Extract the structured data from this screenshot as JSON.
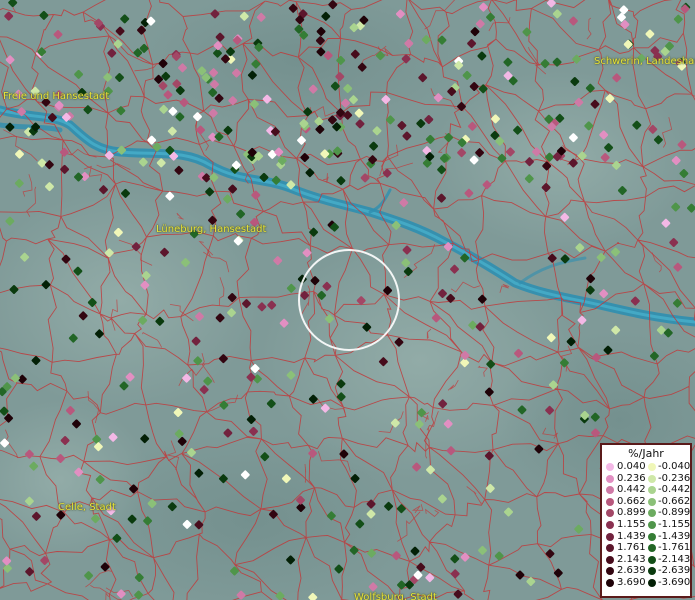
{
  "map": {
    "background_color": "#7f9a98",
    "river_color": "#2f8fb0",
    "boundary_color": "#c0393b",
    "label_color": "#e8e43a",
    "places": [
      {
        "id": "hamburg",
        "label": "Freie und Hansestadt"
      },
      {
        "id": "lueneburg",
        "label": "Lüneburg, Hansestadt"
      },
      {
        "id": "schwerin",
        "label": "Schwerin, Landeshau"
      },
      {
        "id": "celle",
        "label": "Celle, Stadt"
      },
      {
        "id": "wolfsburg",
        "label": "Wolfsburg, Stadt"
      }
    ],
    "focus_marker": "circle-marker"
  },
  "legend": {
    "title": "%/Jahr",
    "positive": [
      {
        "value": "0.040",
        "color": "#f3b8e6"
      },
      {
        "value": "0.236",
        "color": "#e28fc2"
      },
      {
        "value": "0.442",
        "color": "#cf7aa6"
      },
      {
        "value": "0.662",
        "color": "#b8587d"
      },
      {
        "value": "0.899",
        "color": "#a34766"
      },
      {
        "value": "1.155",
        "color": "#8a3050"
      },
      {
        "value": "1.439",
        "color": "#72223e"
      },
      {
        "value": "1.761",
        "color": "#5c162c"
      },
      {
        "value": "2.143",
        "color": "#470c1c"
      },
      {
        "value": "2.639",
        "color": "#330611"
      },
      {
        "value": "3.690",
        "color": "#1f0208"
      }
    ],
    "negative": [
      {
        "value": "-0.040",
        "color": "#f0f7b8"
      },
      {
        "value": "-0.236",
        "color": "#cfe8a8"
      },
      {
        "value": "-0.442",
        "color": "#aad48f"
      },
      {
        "value": "-0.662",
        "color": "#8bc078"
      },
      {
        "value": "-0.899",
        "color": "#6cab60"
      },
      {
        "value": "-1.155",
        "color": "#4f954a"
      },
      {
        "value": "-1.439",
        "color": "#357d35"
      },
      {
        "value": "-1.761",
        "color": "#226626"
      },
      {
        "value": "-2.143",
        "color": "#134f18"
      },
      {
        "value": "-2.639",
        "color": "#0a3a0e"
      },
      {
        "value": "-3.690",
        "color": "#032006"
      }
    ]
  }
}
